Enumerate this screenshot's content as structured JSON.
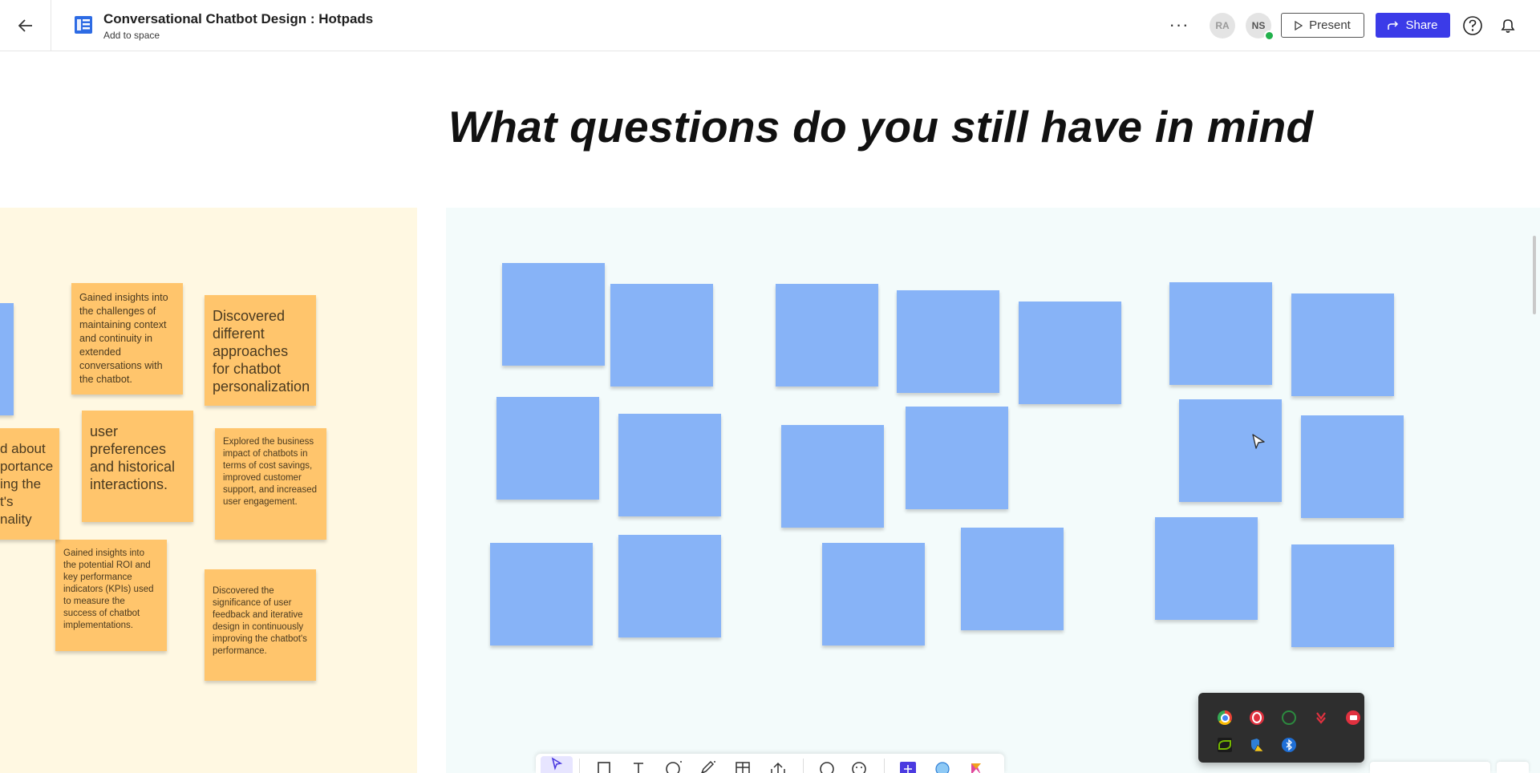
{
  "header": {
    "doc_title": "Conversational Chatbot Design : Hotpads",
    "doc_subtitle": "Add to space",
    "more_label": "···",
    "avatars": [
      "RA",
      "NS"
    ],
    "present_label": "Present",
    "share_label": "Share",
    "colors": {
      "share_bg": "#3b3be8",
      "doc_icon": "#2d6be4"
    }
  },
  "canvas": {
    "title": "What questions do you still have in mind"
  },
  "yellow_notes": [
    {
      "text": "Gained insights into the challenges of maintaining context and continuity in extended conversations with the chatbot."
    },
    {
      "text": "Discovered different approaches for chatbot personalization"
    },
    {
      "text": "user preferences and historical interactions."
    },
    {
      "text": "Explored the business impact of chatbots in terms of cost savings, improved customer support, and increased user engagement."
    },
    {
      "text": "Gained insights into the potential ROI and key performance indicators (KPIs) used to measure the success of chatbot implementations."
    },
    {
      "text": "Discovered the significance of user feedback and iterative design in continuously improving the chatbot's performance."
    },
    {
      "text": "d about\nportance\ning the\nt's\nnality"
    }
  ],
  "colors": {
    "yellow_frame": "#fff8e2",
    "blue_frame": "#f3fbfb",
    "yellow_sticky": "#ffc56c",
    "blue_sticky": "#87b3f7"
  },
  "toolbar": {
    "tools": [
      "select-tool",
      "rectangle-tool",
      "text-tool",
      "shape-tool",
      "pen-tool",
      "table-tool",
      "upload-tool",
      "comment-tool",
      "emoji-tool",
      "add-app-tool",
      "timer-tool",
      "apps-tool"
    ]
  },
  "tray": {
    "icons": [
      "chrome-icon",
      "opera-icon",
      "sync-icon",
      "download-icon",
      "app-icon",
      "nvidia-icon",
      "security-icon",
      "bluetooth-icon"
    ]
  }
}
